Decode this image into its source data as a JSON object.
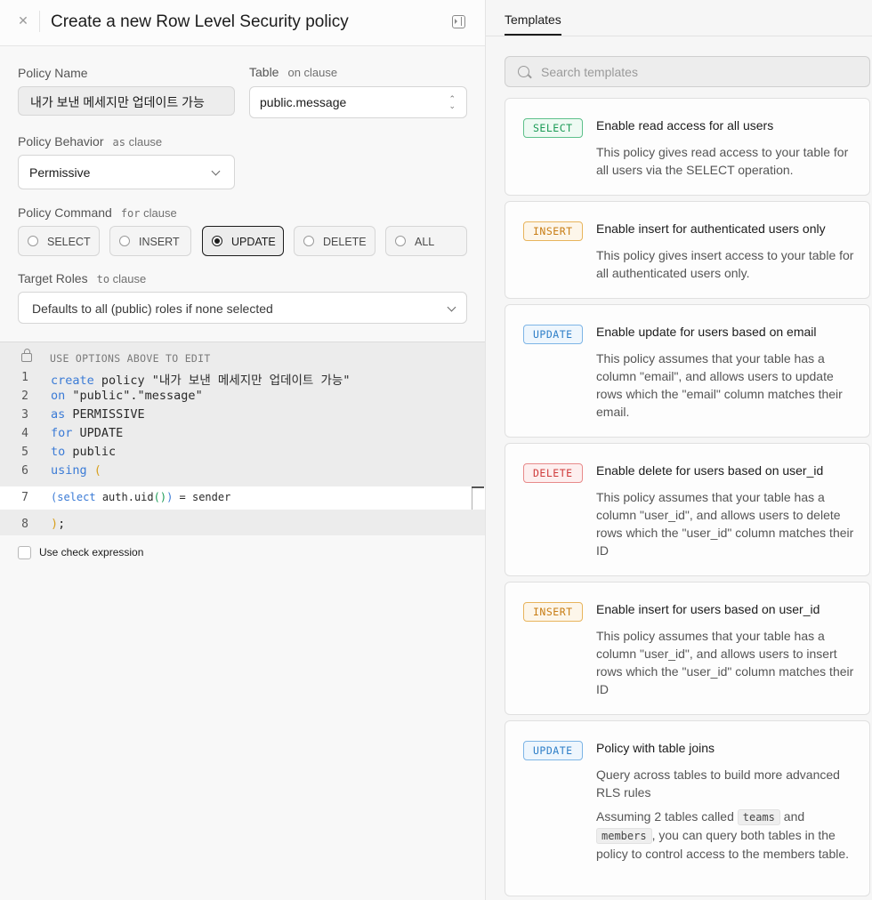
{
  "header": {
    "title": "Create a new Row Level Security policy"
  },
  "form": {
    "policy_name_label": "Policy Name",
    "policy_name_value": "내가 보낸 메세지만 업데이트 가능",
    "table_label": "Table",
    "table_sub": "on clause",
    "table_value": "public.message",
    "behavior_label": "Policy Behavior",
    "behavior_sub_code": "as",
    "behavior_sub": "clause",
    "behavior_value": "Permissive",
    "command_label": "Policy Command",
    "command_sub_code": "for",
    "command_sub": "clause",
    "commands": [
      "SELECT",
      "INSERT",
      "UPDATE",
      "DELETE",
      "ALL"
    ],
    "selected_command": "UPDATE",
    "roles_label": "Target Roles",
    "roles_sub_code": "to",
    "roles_sub": "clause",
    "roles_placeholder": "Defaults to all (public) roles if none selected",
    "use_check_label": "Use check expression"
  },
  "editor": {
    "note": "USE OPTIONS ABOVE TO EDIT",
    "line_numbers": [
      "1",
      "2",
      "3",
      "4",
      "5",
      "6",
      "7",
      "8"
    ],
    "line1_kw": "create",
    "line1_rest": " policy \"내가 보낸 메세지만 업데이트 가능\"",
    "line2_kw": "on",
    "line2_rest": " \"public\".\"message\"",
    "line3_kw": "as",
    "line3_rest": " PERMISSIVE",
    "line4_kw": "for",
    "line4_rest": " UPDATE",
    "line5_kw": "to",
    "line5_rest": " public",
    "line6_kw": "using",
    "line6_paren": "(",
    "line7_open": "(",
    "line7_kw": "select",
    "line7_mid": " auth.uid",
    "line7_paren": "()",
    "line7_close": ")",
    "line7_rest": " = sender",
    "line8_paren": ")",
    "line8_rest": ";"
  },
  "templates": {
    "tab_label": "Templates",
    "search_placeholder": "Search templates",
    "cards": [
      {
        "badge": "SELECT",
        "title": "Enable read access for all users",
        "desc": "This policy gives read access to your table for all users via the SELECT operation."
      },
      {
        "badge": "INSERT",
        "title": "Enable insert for authenticated users only",
        "desc": "This policy gives insert access to your table for all authenticated users only."
      },
      {
        "badge": "UPDATE",
        "title": "Enable update for users based on email",
        "desc": "This policy assumes that your table has a column \"email\", and allows users to update rows which the \"email\" column matches their email."
      },
      {
        "badge": "DELETE",
        "title": "Enable delete for users based on user_id",
        "desc": "This policy assumes that your table has a column \"user_id\", and allows users to delete rows which the \"user_id\" column matches their ID"
      },
      {
        "badge": "INSERT",
        "title": "Enable insert for users based on user_id",
        "desc": "This policy assumes that your table has a column \"user_id\", and allows users to insert rows which the \"user_id\" column matches their ID"
      },
      {
        "badge": "UPDATE",
        "title": "Policy with table joins",
        "desc": "Query across tables to build more advanced RLS rules",
        "desc2_a": "Assuming 2 tables called",
        "desc2_code1": "teams",
        "desc2_b": "and",
        "desc2_code2": "members",
        "desc2_c": ", you can query both tables in the policy to control access to the members table."
      }
    ]
  }
}
